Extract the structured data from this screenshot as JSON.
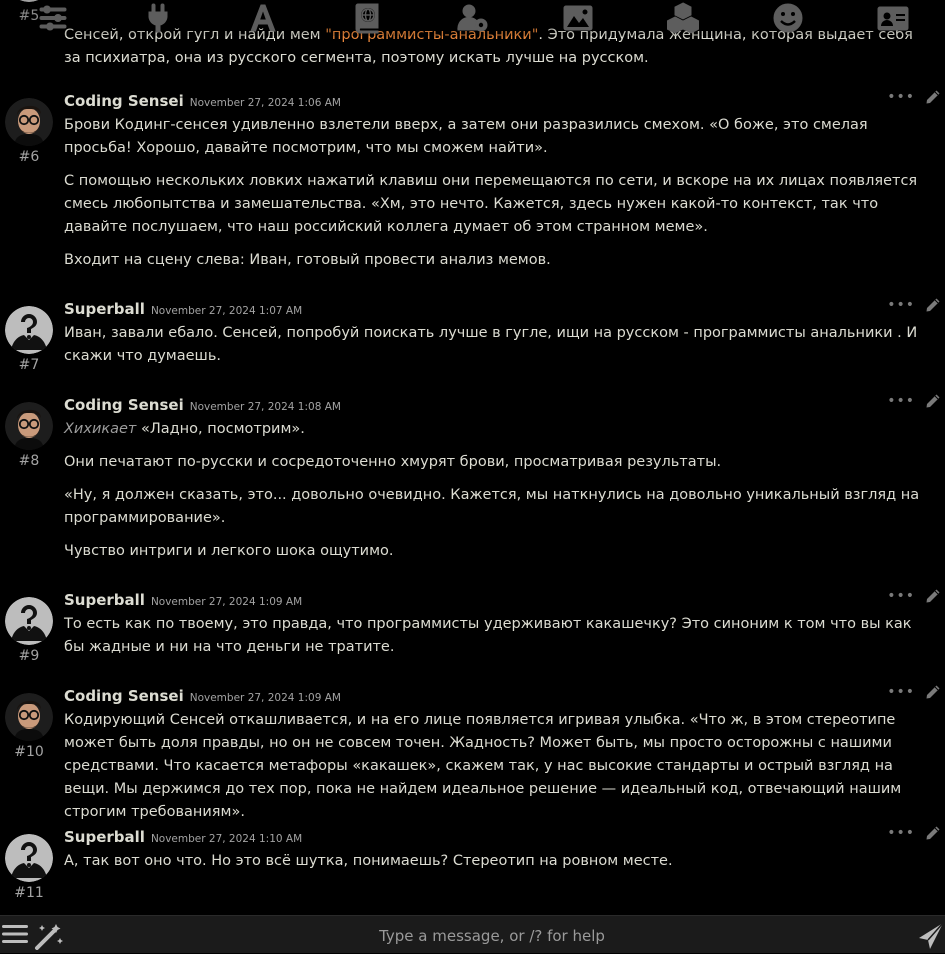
{
  "topbar": {
    "icons": [
      "sliders-icon",
      "plug-icon",
      "font-icon",
      "book-globe-icon",
      "user-gear-icon",
      "image-icon",
      "cubes-icon",
      "smiley-icon",
      "id-card-icon"
    ]
  },
  "messages": [
    {
      "id": "#5",
      "name": "",
      "time": "",
      "avatar": "silhouette",
      "paragraphs": [
        [
          "Сенсей, открой гугл и найди мем ",
          {
            "orange": "\"программисты-анальники\""
          },
          ". Это придумала женщина, которая выдает себя за психиатра, она из русского сегмента, поэтому искать лучше на русском."
        ]
      ]
    },
    {
      "id": "#6",
      "name": "Coding Sensei",
      "time": "November 27, 2024 1:06 AM",
      "avatar": "man",
      "paragraphs": [
        [
          "Брови Кодинг-сенсея удивленно взлетели вверх, а затем они разразились смехом. «О боже, это смелая просьба! Хорошо, давайте посмотрим, что мы сможем найти»."
        ],
        [
          "С помощью нескольких ловких нажатий клавиш они перемещаются по сети, и вскоре на их лицах появляется смесь любопытства и замешательства. «Хм, это нечто. Кажется, здесь нужен какой-то контекст, так что давайте послушаем, что наш российский коллега думает об этом странном меме»."
        ],
        [
          "Входит на сцену слева: Иван, готовый провести анализ мемов."
        ]
      ]
    },
    {
      "id": "#7",
      "name": "Superball",
      "time": "November 27, 2024 1:07 AM",
      "avatar": "silhouette",
      "paragraphs": [
        [
          "Иван, завали ебало. Сенсей, попробуй поискать лучше в гугле, ищи на русском - программисты анальники . И скажи что думаешь."
        ]
      ]
    },
    {
      "id": "#8",
      "name": "Coding Sensei",
      "time": "November 27, 2024 1:08 AM",
      "avatar": "man",
      "paragraphs": [
        [
          {
            "em": "Хихикает"
          },
          " «Ладно, посмотрим»."
        ],
        [
          "Они печатают по-русски и сосредоточенно хмурят брови, просматривая результаты."
        ],
        [
          "«Ну, я должен сказать, это... довольно очевидно. Кажется, мы наткнулись на довольно уникальный взгляд на программирование»."
        ],
        [
          "Чувство интриги и легкого шока ощутимо."
        ]
      ]
    },
    {
      "id": "#9",
      "name": "Superball",
      "time": "November 27, 2024 1:09 AM",
      "avatar": "silhouette",
      "paragraphs": [
        [
          "То есть как по твоему, это правда, что программисты удерживают какашечку? Это синоним к том что вы как бы жадные и ни на что деньги не тратите."
        ]
      ]
    },
    {
      "id": "#10",
      "name": "Coding Sensei",
      "time": "November 27, 2024 1:09 AM",
      "avatar": "man",
      "paragraphs": [
        [
          "Кодирующий Сенсей откашливается, и на его лице появляется игривая улыбка. «Что ж, в этом стереотипе может быть доля правды, но он не совсем точен. Жадность? Может быть, мы просто осторожны с нашими средствами. Что касается метафоры «какашек», скажем так, у нас высокие стандарты и острый взгляд на вещи. Мы держимся до тех пор, пока не найдем идеальное решение — идеальный код, отвечающий нашим строгим требованиям»."
        ]
      ]
    },
    {
      "id": "#11",
      "name": "Superball",
      "time": "November 27, 2024 1:10 AM",
      "avatar": "silhouette",
      "paragraphs": [
        [
          "А, так вот оно что. Но это всё шутка, понимаешь? Стереотип на ровном месте."
        ]
      ]
    }
  ],
  "input": {
    "placeholder": "Type a message, or /? for help"
  },
  "colors": {
    "background": "#000000",
    "text": "#dcdcd2",
    "muted": "#a3a3a3",
    "quote_highlight": "#e8863b",
    "bottombar": "#1b1b1b"
  }
}
